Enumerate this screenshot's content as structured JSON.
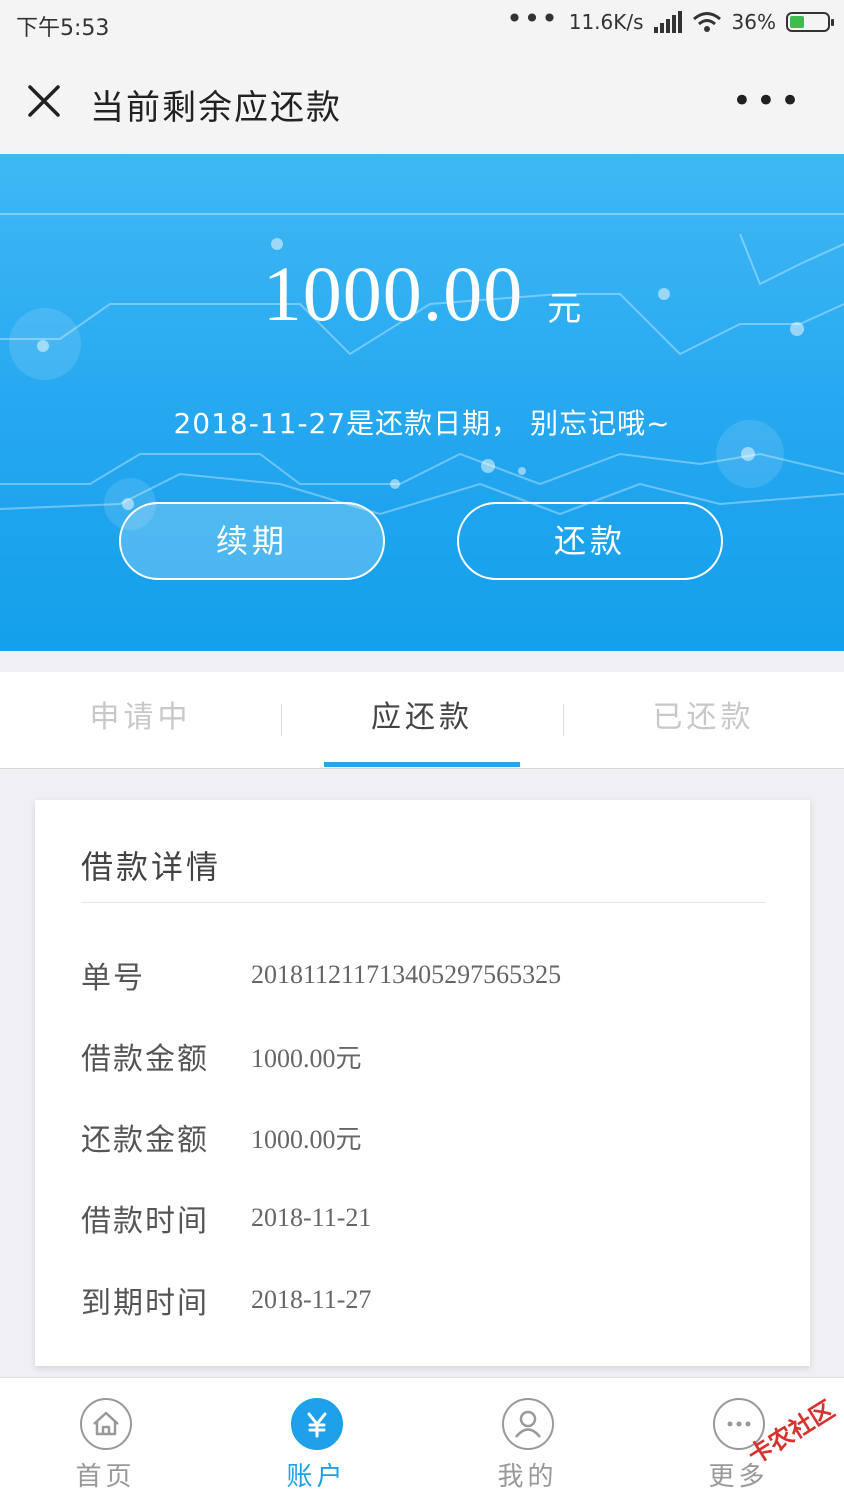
{
  "status_bar": {
    "time": "下午5:53",
    "network_speed": "11.6K/s",
    "battery": "36%",
    "battery_level": 0.36
  },
  "nav": {
    "title": "当前剩余应还款",
    "more_glyph": "•••"
  },
  "hero": {
    "amount": "1000.00",
    "unit": "元",
    "due_notice": "2018-11-27是还款日期， 别忘记哦~",
    "renew_button": "续期",
    "repay_button": "还款"
  },
  "tabs": [
    {
      "label": "申请中",
      "active": false
    },
    {
      "label": "应还款",
      "active": true
    },
    {
      "label": "已还款",
      "active": false
    }
  ],
  "loan_details": {
    "title": "借款详情",
    "rows": [
      {
        "label": "单号",
        "value": "20181121171340529756532​5"
      },
      {
        "label": "借款金额",
        "value": "1000.00元"
      },
      {
        "label": "还款金额",
        "value": "1000.00元"
      },
      {
        "label": "借款时间",
        "value": "2018-11-21"
      },
      {
        "label": "到期时间",
        "value": "2018-11-27"
      }
    ]
  },
  "tabbar": [
    {
      "label": "首页",
      "icon": "home-icon",
      "active": false
    },
    {
      "label": "账户",
      "icon": "yen-icon",
      "active": true
    },
    {
      "label": "我的",
      "icon": "user-icon",
      "active": false
    },
    {
      "label": "更多",
      "icon": "more-icon",
      "active": false
    }
  ],
  "watermark": "卡农社区",
  "colors": {
    "accent": "#1ea1ea",
    "hero_top": "#3fb8f5",
    "hero_bottom": "#14a0eb",
    "inactive_tab": "#c8c8c8"
  }
}
